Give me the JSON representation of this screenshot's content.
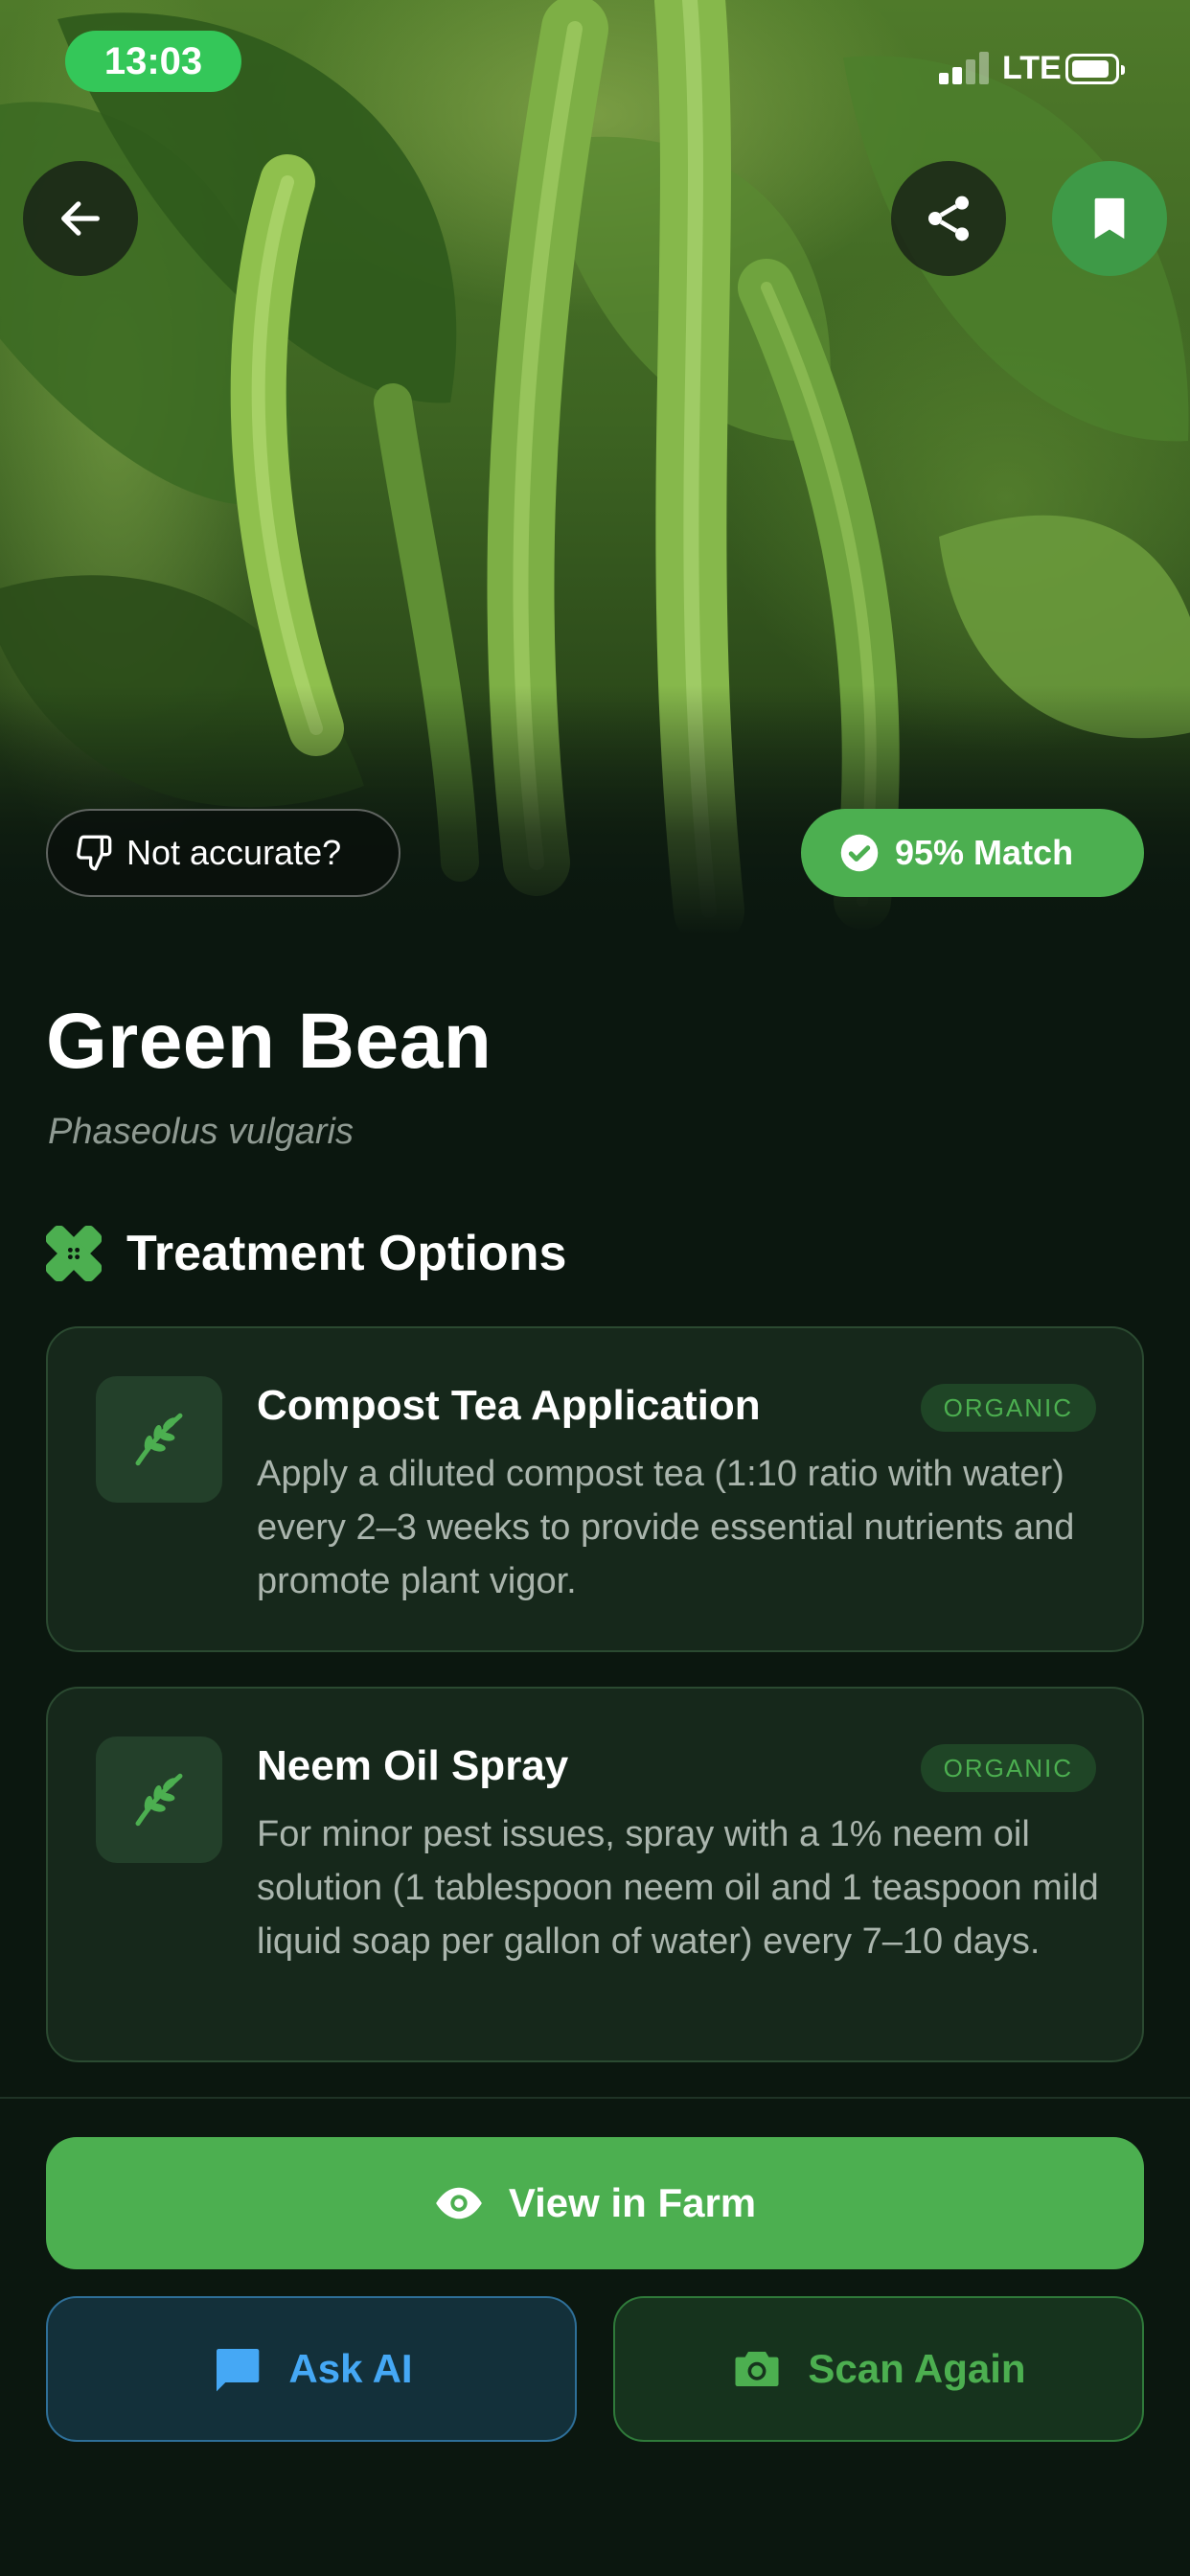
{
  "status_bar": {
    "time": "13:03",
    "network": "LTE",
    "signal_bars_active": 2,
    "signal_bars_total": 4
  },
  "hero": {
    "image_subject": "green bean plant photo",
    "not_accurate_label": "Not accurate?",
    "match_label": "95% Match",
    "match_percent": 95
  },
  "plant": {
    "common_name": "Green Bean",
    "scientific_name": "Phaseolus vulgaris"
  },
  "treatment": {
    "section_title": "Treatment Options",
    "section_icon": "bandage-icon",
    "options": [
      {
        "icon": "leaf-icon",
        "title": "Compost Tea Application",
        "badge": "ORGANIC",
        "description": "Apply a diluted compost tea (1:10 ratio with water) every 2–3 weeks to provide essential nutrients and promote plant vigor."
      },
      {
        "icon": "leaf-icon",
        "title": "Neem Oil Spray",
        "badge": "ORGANIC",
        "description": "For minor pest issues, spray with a 1% neem oil solution (1 tablespoon neem oil and 1 teaspoon mild liquid soap per gallon of water) every 7–10 days."
      }
    ]
  },
  "actions": {
    "view_in_farm": "View in Farm",
    "ask_ai": "Ask AI",
    "scan_again": "Scan Again"
  },
  "colors": {
    "accent_green": "#4caf50",
    "ai_blue": "#45a8f5",
    "background": "#0b170f",
    "card_background": "#16281b"
  },
  "icons": {
    "back": "arrow-left-icon",
    "share": "share-icon",
    "bookmark": "bookmark-icon",
    "thumbs_down": "thumbs-down-icon",
    "check": "check-circle-icon",
    "eye": "eye-icon",
    "chat": "chat-icon",
    "camera": "camera-icon"
  }
}
